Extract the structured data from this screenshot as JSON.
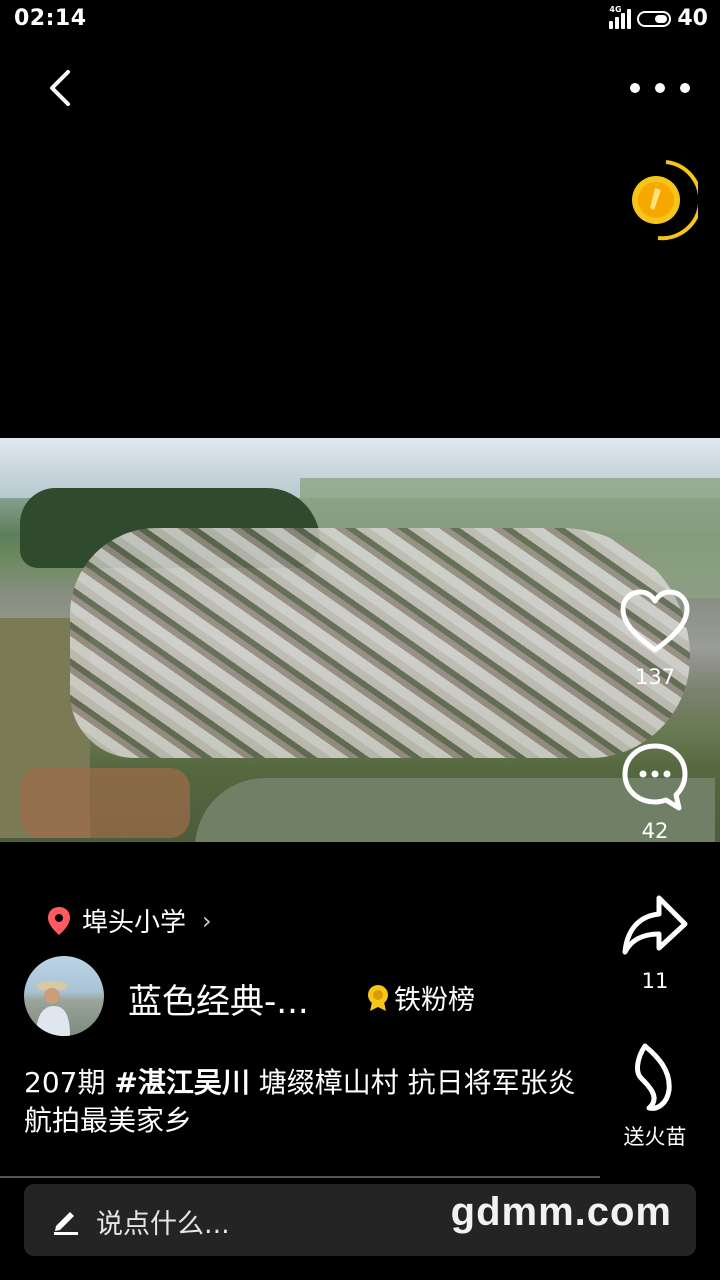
{
  "status_bar": {
    "time": "02:14",
    "network": "4G",
    "battery": "40"
  },
  "video": {
    "description_icon": "aerial-village-video"
  },
  "actions": {
    "like_count": "137",
    "comment_count": "42",
    "share_count": "11",
    "fire_label": "送火苗"
  },
  "location": {
    "name": "埠头小学"
  },
  "author": {
    "name": "蓝色经典-...",
    "badge": "铁粉榜"
  },
  "caption": {
    "prefix": "207期 ",
    "hashtag": "#湛江吴川",
    "text": "  塘缀樟山村 抗日将军张炎 航拍最美家乡"
  },
  "comment_input": {
    "placeholder": "说点什么..."
  },
  "watermark": "gdmm.com",
  "colors": {
    "background": "#000000",
    "coin": "#f5c518",
    "location_pin": "#ff5a5f"
  }
}
